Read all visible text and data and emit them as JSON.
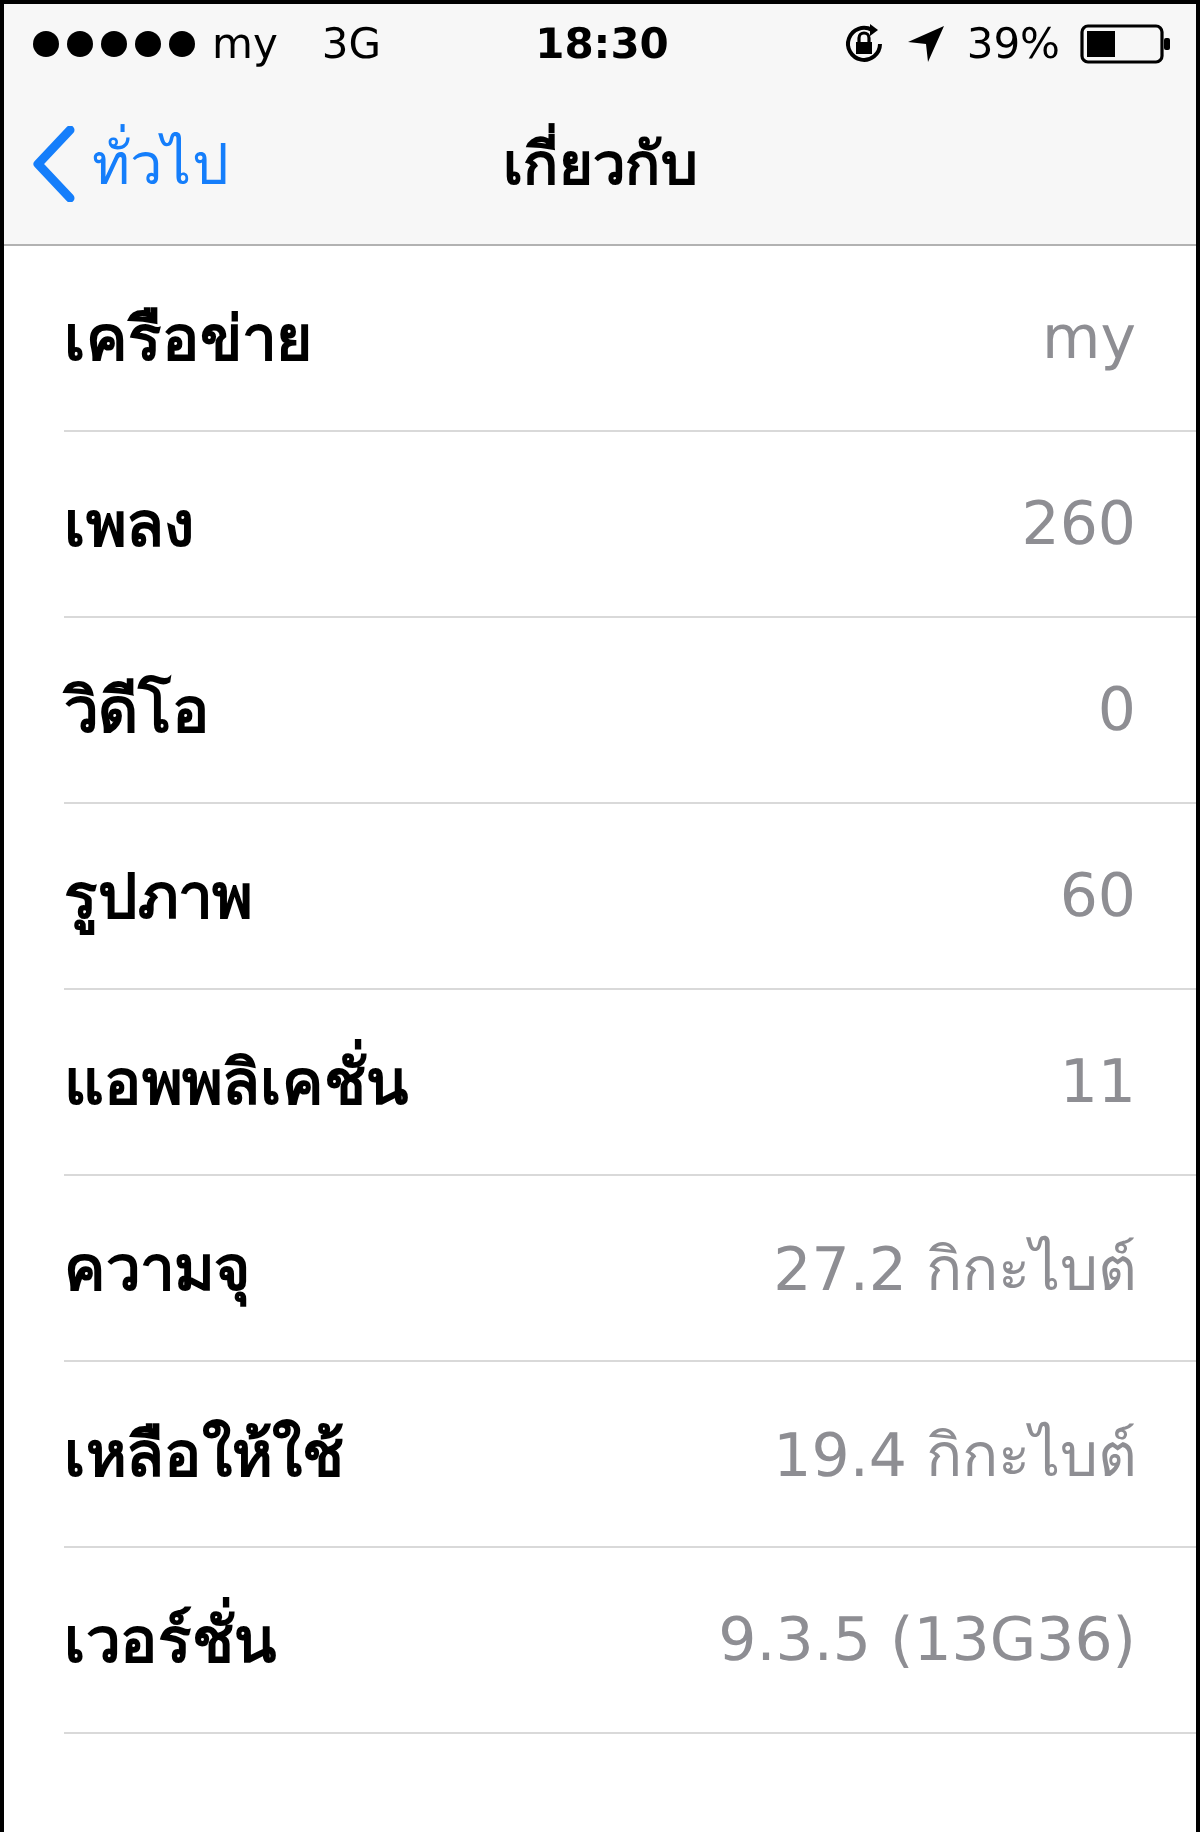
{
  "status_bar": {
    "carrier": "my",
    "network": "3G",
    "time": "18:30",
    "battery": "39%"
  },
  "nav": {
    "back": "ทั่วไป",
    "title": "เกี่ยวกับ"
  },
  "rows": [
    {
      "label": "เครือข่าย",
      "value": "my"
    },
    {
      "label": "เพลง",
      "value": "260"
    },
    {
      "label": "วิดีโอ",
      "value": "0"
    },
    {
      "label": "รูปภาพ",
      "value": "60"
    },
    {
      "label": "แอพพลิเคชั่น",
      "value": "11"
    },
    {
      "label": "ความจุ",
      "value": "27.2 กิกะไบต์"
    },
    {
      "label": "เหลือให้ใช้",
      "value": "19.4 กิกะไบต์"
    },
    {
      "label": "เวอร์ชั่น",
      "value": "9.3.5 (13G36)"
    }
  ]
}
